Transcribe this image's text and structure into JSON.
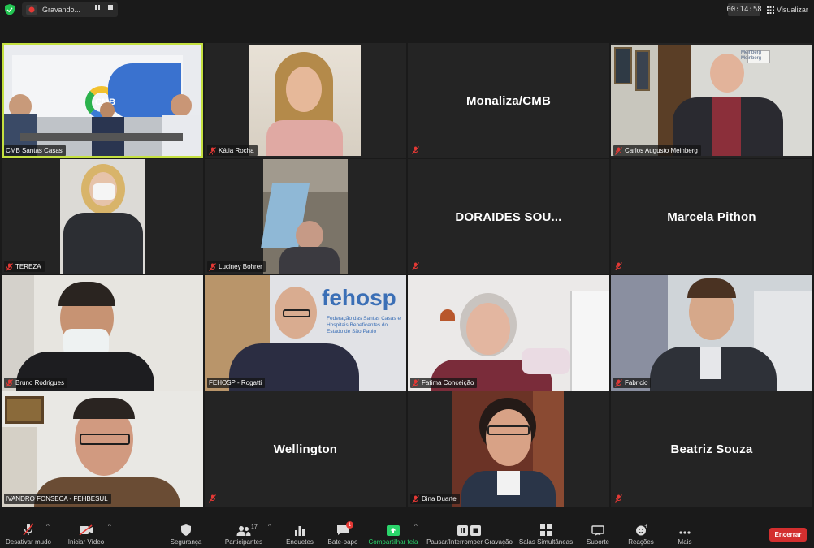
{
  "topbar": {
    "recording_label": "Gravando...",
    "timer": "00:14:58",
    "view_label": "Visualizar"
  },
  "tiles": [
    {
      "id": "cmb",
      "name": "CMB Santas Casas",
      "has_video": true,
      "active": true,
      "muted": false
    },
    {
      "id": "katia",
      "name": "Kátia Rocha",
      "has_video": true,
      "muted": true
    },
    {
      "id": "monaliza",
      "name": "Monaliza/CMB",
      "has_video": false,
      "muted": true
    },
    {
      "id": "carlos",
      "name": "Carlos Augusto Meinberg",
      "has_video": true,
      "muted": true
    },
    {
      "id": "tereza",
      "name": "TEREZA",
      "has_video": true,
      "muted": true
    },
    {
      "id": "luciney",
      "name": "Luciney Bohrer",
      "has_video": true,
      "muted": true
    },
    {
      "id": "doraides",
      "name": "DORAIDES SOU...",
      "has_video": false,
      "muted": true
    },
    {
      "id": "marcela",
      "name": "Marcela Pithon",
      "has_video": false,
      "muted": true
    },
    {
      "id": "bruno",
      "name": "Bruno Rodrigues",
      "has_video": true,
      "muted": true
    },
    {
      "id": "fehosp",
      "name": "FEHOSP - Rogatti",
      "has_video": true,
      "muted": false
    },
    {
      "id": "fatima",
      "name": "Fatima Conceição",
      "has_video": true,
      "muted": true
    },
    {
      "id": "fabricio",
      "name": "Fabricio",
      "has_video": true,
      "muted": true
    },
    {
      "id": "ivandro",
      "name": "IVANDRO FONSECA - FEHBESUL",
      "has_video": true,
      "muted": false
    },
    {
      "id": "wellington",
      "name": "Wellington",
      "has_video": false,
      "muted": true
    },
    {
      "id": "dina",
      "name": "Dina Duarte",
      "has_video": true,
      "muted": true
    },
    {
      "id": "beatriz",
      "name": "Beatriz Souza",
      "has_video": false,
      "muted": true
    }
  ],
  "video_text": {
    "cmb_logo": "CMB",
    "fehosp_logo": "fehosp",
    "fehosp_sub": "Federação das Santas Casas e Hospitais Beneficentes do Estado de São Paulo",
    "meinberg_sign": "Meinberg Meinberg"
  },
  "toolbar": {
    "mute": "Desativar mudo",
    "video": "Iniciar Vídeo",
    "security": "Segurança",
    "participants": "Participantes",
    "participants_count": "17",
    "polls": "Enquetes",
    "chat": "Bate-papo",
    "chat_badge": "1",
    "share": "Compartilhar tela",
    "record": "Pausar/Interromper Gravação",
    "breakout": "Salas Simultâneas",
    "support": "Suporte",
    "reactions": "Reações",
    "more": "Mais",
    "end": "Encerrar"
  },
  "colors": {
    "active_speaker": "#c4e040",
    "share_green": "#2bd56b",
    "end_red": "#d32f2f",
    "muted_red": "#e53935"
  }
}
